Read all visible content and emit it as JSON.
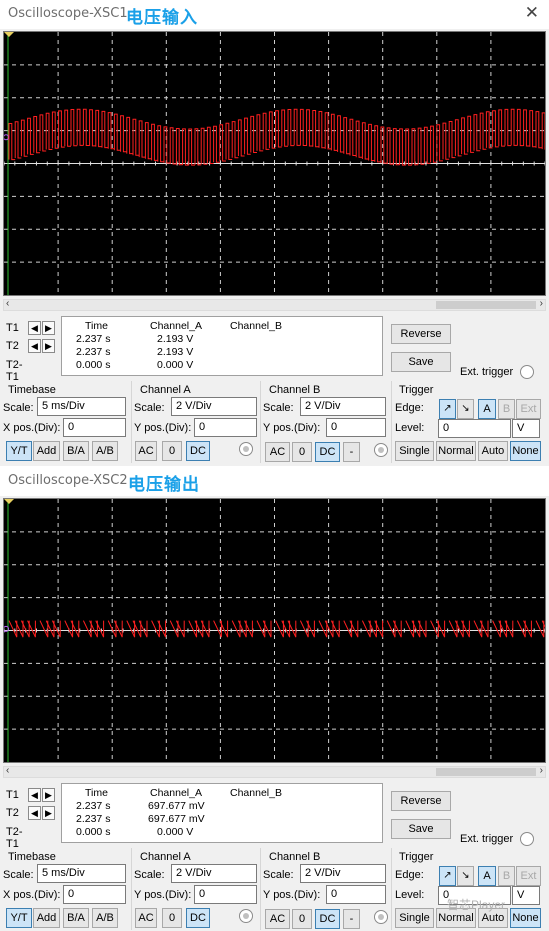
{
  "scopes": [
    {
      "title": "Oscilloscope-XSC1",
      "title_cn": "电压输入",
      "cursors": {
        "t1": "T1",
        "t2": "T2",
        "diff": "T2-T1"
      },
      "readout": {
        "headers": [
          "Time",
          "Channel_A",
          "Channel_B"
        ],
        "rows": [
          [
            "2.237 s",
            "2.193 V",
            ""
          ],
          [
            "2.237 s",
            "2.193 V",
            ""
          ],
          [
            "0.000 s",
            "0.000 V",
            ""
          ]
        ]
      },
      "buttons": {
        "reverse": "Reverse",
        "save": "Save"
      },
      "ext_trigger": "Ext. trigger",
      "timebase": {
        "title": "Timebase",
        "scale_label": "Scale:",
        "scale": "5 ms/Div",
        "xpos_label": "X pos.(Div):",
        "xpos": "0",
        "modes": [
          "Y/T",
          "Add",
          "B/A",
          "A/B"
        ]
      },
      "channel_a": {
        "title": "Channel A",
        "scale_label": "Scale:",
        "scale": "2  V/Div",
        "ypos_label": "Y pos.(Div):",
        "ypos": "0",
        "coupling": [
          "AC",
          "0",
          "DC"
        ]
      },
      "channel_b": {
        "title": "Channel B",
        "scale_label": "Scale:",
        "scale": "2  V/Div",
        "ypos_label": "Y pos.(Div):",
        "ypos": "0",
        "coupling": [
          "AC",
          "0",
          "DC",
          "-"
        ]
      },
      "trigger": {
        "title": "Trigger",
        "edge_label": "Edge:",
        "sources": [
          "A",
          "B",
          "Ext"
        ],
        "level_label": "Level:",
        "level": "0",
        "level_unit": "V",
        "modes": [
          "Single",
          "Normal",
          "Auto",
          "None"
        ]
      },
      "waveform": {
        "kind": "pwm-on-sine",
        "color": "#ff2020",
        "center_div": 0.8,
        "sine_amp_div": 0.3,
        "pulse_div": 1.1,
        "periods": 2.5
      }
    },
    {
      "title": "Oscilloscope-XSC2",
      "title_cn": "电压输出",
      "cursors": {
        "t1": "T1",
        "t2": "T2",
        "diff": "T2-T1"
      },
      "readout": {
        "headers": [
          "Time",
          "Channel_A",
          "Channel_B"
        ],
        "rows": [
          [
            "2.237 s",
            "697.677 mV",
            ""
          ],
          [
            "2.237 s",
            "697.677 mV",
            ""
          ],
          [
            "0.000 s",
            "0.000 V",
            ""
          ]
        ]
      },
      "buttons": {
        "reverse": "Reverse",
        "save": "Save"
      },
      "ext_trigger": "Ext. trigger",
      "timebase": {
        "title": "Timebase",
        "scale_label": "Scale:",
        "scale": "5 ms/Div",
        "xpos_label": "X pos.(Div):",
        "xpos": "0",
        "modes": [
          "Y/T",
          "Add",
          "B/A",
          "A/B"
        ]
      },
      "channel_a": {
        "title": "Channel A",
        "scale_label": "Scale:",
        "scale": "2  V/Div",
        "ypos_label": "Y pos.(Div):",
        "ypos": "0",
        "coupling": [
          "AC",
          "0",
          "DC"
        ]
      },
      "channel_b": {
        "title": "Channel B",
        "scale_label": "Scale:",
        "scale": "2  V/Div",
        "ypos_label": "Y pos.(Div):",
        "ypos": "0",
        "coupling": [
          "AC",
          "0",
          "DC",
          "-"
        ]
      },
      "trigger": {
        "title": "Trigger",
        "edge_label": "Edge:",
        "sources": [
          "A",
          "B",
          "Ext"
        ],
        "level_label": "Level:",
        "level": "0",
        "level_unit": "V",
        "modes": [
          "Single",
          "Normal",
          "Auto",
          "None"
        ]
      },
      "waveform": {
        "kind": "sawtooth",
        "color": "#ff2020",
        "center_div": 0.05,
        "sine_amp_div": 0.0,
        "pulse_div": 0.5,
        "periods": 0
      }
    }
  ],
  "watermark": "智芯Player"
}
